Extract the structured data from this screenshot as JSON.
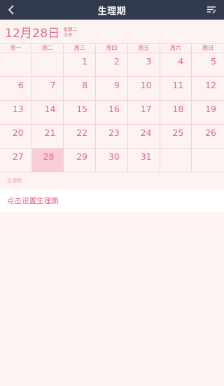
{
  "topbar": {
    "title": "生理期",
    "back_icon": "chevron-left-icon",
    "menu_icon": "list-edit-icon",
    "bg_color": "#323a4d"
  },
  "header": {
    "date": "12月28日",
    "weekday": "星期二",
    "today_label": "今天"
  },
  "weekdays": [
    "周一",
    "周二",
    "周三",
    "周四",
    "周五",
    "周六",
    "周日"
  ],
  "calendar": {
    "weeks": [
      [
        "",
        "",
        "1",
        "2",
        "3",
        "4",
        "5"
      ],
      [
        "6",
        "7",
        "8",
        "9",
        "10",
        "11",
        "12"
      ],
      [
        "13",
        "14",
        "15",
        "16",
        "17",
        "18",
        "19"
      ],
      [
        "20",
        "21",
        "22",
        "23",
        "24",
        "25",
        "26"
      ],
      [
        "27",
        "28",
        "29",
        "30",
        "31",
        "",
        ""
      ]
    ],
    "today": "28",
    "accent_color": "#e0687f",
    "today_bg": "#f8cfd6"
  },
  "period": {
    "section_label": "生理期",
    "set_label": "点击设置生理期"
  }
}
